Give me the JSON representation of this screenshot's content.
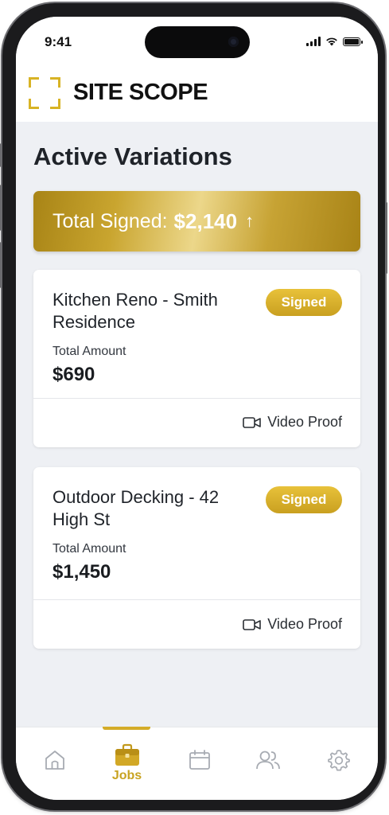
{
  "status_bar": {
    "time": "9:41"
  },
  "header": {
    "brand": "SITE SCOPE"
  },
  "page": {
    "title": "Active Variations"
  },
  "summary": {
    "label": "Total Signed:",
    "amount": "$2,140",
    "trend_symbol": "↑"
  },
  "cards": [
    {
      "title": "Kitchen Reno - Smith Residence",
      "status": "Signed",
      "amount_label": "Total Amount",
      "amount": "$690",
      "proof_label": "Video Proof"
    },
    {
      "title": "Outdoor Decking - 42 High St",
      "status": "Signed",
      "amount_label": "Total Amount",
      "amount": "$1,450",
      "proof_label": "Video Proof"
    }
  ],
  "tabbar": {
    "active": "Jobs",
    "items": [
      {
        "icon": "home-icon",
        "label": ""
      },
      {
        "icon": "briefcase-icon",
        "label": "Jobs"
      },
      {
        "icon": "calendar-icon",
        "label": ""
      },
      {
        "icon": "users-icon",
        "label": ""
      },
      {
        "icon": "settings-icon",
        "label": ""
      }
    ]
  },
  "colors": {
    "accent": "#d4ac28",
    "background": "#eef0f4",
    "text": "#1f2329"
  }
}
